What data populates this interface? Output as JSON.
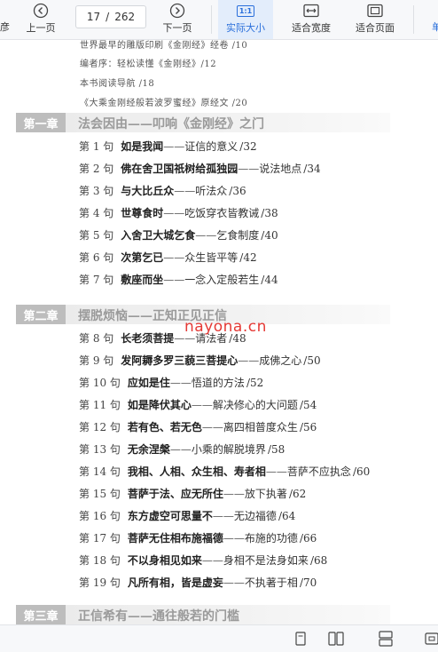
{
  "toolbar": {
    "left_fragment": "彦",
    "prev_label": "上一页",
    "page_current": "17",
    "page_sep": "/",
    "page_total": "262",
    "next_label": "下一页",
    "actual_size_label": "实际大小",
    "fit_width_label": "适合宽度",
    "fit_page_label": "适合页面",
    "right_fragment": "单",
    "actual_size_icon": "1:1",
    "active_color": "#2a6fdb"
  },
  "document": {
    "pre_lines": [
      "世界最早的雕版印刷《金刚经》经卷 /10",
      "编者序：轻松读懂《金刚经》/12",
      "本书阅读导航 /18",
      "《大乘金刚经般若波罗蜜经》原经文 /20"
    ],
    "chapters": [
      {
        "tag": "第一章",
        "title": "法会因由——叩响《金刚经》之门",
        "entries": [
          {
            "num": "第 1 句",
            "key": "如是我闻",
            "desc": "证信的意义",
            "page": "/32"
          },
          {
            "num": "第 2 句",
            "key": "佛在舍卫国祇树给孤独园",
            "desc": "说法地点",
            "page": "/34"
          },
          {
            "num": "第 3 句",
            "key": "与大比丘众",
            "desc": "听法众",
            "page": "/36"
          },
          {
            "num": "第 4 句",
            "key": "世尊食时",
            "desc": "吃饭穿衣皆教诫",
            "page": "/38"
          },
          {
            "num": "第 5 句",
            "key": "入舍卫大城乞食",
            "desc": "乞食制度",
            "page": "/40"
          },
          {
            "num": "第 6 句",
            "key": "次第乞已",
            "desc": "众生皆平等",
            "page": "/42"
          },
          {
            "num": "第 7 句",
            "key": "敷座而坐",
            "desc": "一念入定般若生",
            "page": "/44"
          }
        ]
      },
      {
        "tag": "第二章",
        "title": "摆脱烦恼——正知正见正信",
        "entries": [
          {
            "num": "第 8 句",
            "key": "长老须菩提",
            "desc": "请法者",
            "page": "/48"
          },
          {
            "num": "第 9 句",
            "key": "发阿耨多罗三藐三菩提心",
            "desc": "成佛之心",
            "page": "/50"
          },
          {
            "num": "第 10 句",
            "key": "应如是住",
            "desc": "悟道的方法",
            "page": "/52"
          },
          {
            "num": "第 11 句",
            "key": "如是降伏其心",
            "desc": "解决修心的大问题",
            "page": "/54"
          },
          {
            "num": "第 12 句",
            "key": "若有色、若无色",
            "desc": "离四相普度众生",
            "page": "/56"
          },
          {
            "num": "第 13 句",
            "key": "无余涅槃",
            "desc": "小乘的解脱境界",
            "page": "/58"
          },
          {
            "num": "第 14 句",
            "key": "我相、人相、众生相、寿者相",
            "desc": "菩萨不应执念",
            "page": "/60"
          },
          {
            "num": "第 15 句",
            "key": "菩萨于法、应无所住",
            "desc": "放下执著",
            "page": "/62"
          },
          {
            "num": "第 16 句",
            "key": "东方虚空可思量不",
            "desc": "无边福德",
            "page": "/64"
          },
          {
            "num": "第 17 句",
            "key": "菩萨无住相布施福德",
            "desc": "布施的功德",
            "page": "/66"
          },
          {
            "num": "第 18 句",
            "key": "不以身相见如来",
            "desc": "身相不是法身如来",
            "page": "/68"
          },
          {
            "num": "第 19 句",
            "key": "凡所有相，皆是虚妄",
            "desc": "不执著于相",
            "page": "/70"
          }
        ]
      },
      {
        "tag": "第三章",
        "title": "正信希有——通往般若的门槛",
        "entries": []
      }
    ],
    "watermark": "nayona.cn",
    "watermark_color": "#e53935",
    "dash": "——"
  }
}
